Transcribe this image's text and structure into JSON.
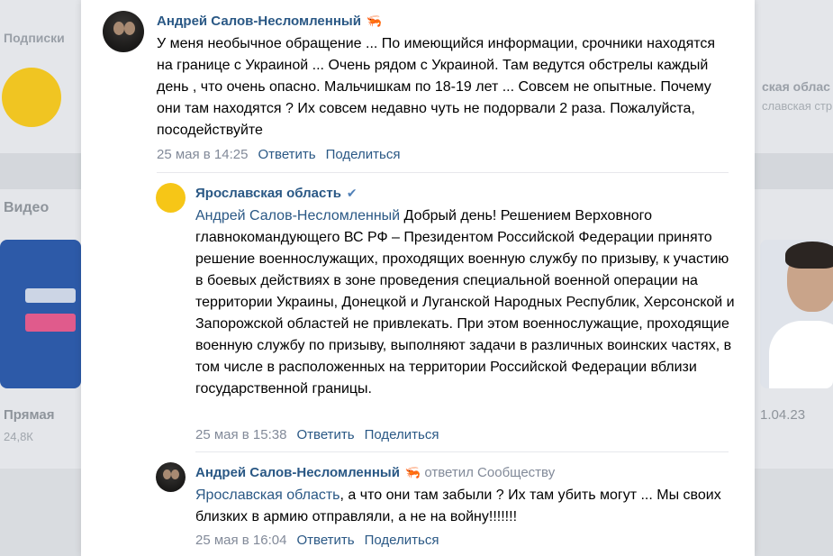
{
  "background": {
    "left": {
      "subscriptions": "Подписки",
      "video": "Видео",
      "live": "Прямая",
      "views": "24,8К"
    },
    "right": {
      "title": "ская облас",
      "subtitle": "славская стр",
      "date": "1.04.23"
    }
  },
  "comments": {
    "first": {
      "author": "Андрей Салов-Несломленный",
      "text": "У меня необычное обращение ... По имеющийся информации, срочники находятся на границе с Украиной ... Очень рядом с Украиной. Там ведутся обстрелы каждый день , что очень опасно. Мальчишкам по 18-19 лет ... Совсем не опытные. Почему они там находятся ? Их совсем недавно чуть не подорвали 2 раза. Пожалуйста, посодействуйте",
      "date": "25 мая в 14:25",
      "reply": "Ответить",
      "share": "Поделиться"
    },
    "second": {
      "author": "Ярославская область",
      "mention": "Андрей Салов-Несломленный",
      "text": " Добрый день! Решением Верховного главнокомандующего ВС РФ – Президентом Российской Федерации принято решение военнослужащих, проходящих военную службу по призыву, к участию в боевых действиях в зоне проведения специальной военной операции на территории Украины, Донецкой и Луганской Народных Республик, Херсонской и Запорожской областей не привлекать. При этом военнослужащие, проходящие военную службу по призыву, выполняют задачи в различных воинских частях, в том числе в расположенных на территории Российской Федерации вблизи государственной границы.",
      "date": "25 мая в 15:38",
      "reply": "Ответить",
      "share": "Поделиться"
    },
    "third": {
      "author": "Андрей Салов-Несломленный",
      "replied": "ответил Сообществу",
      "mention": "Ярославская область",
      "text": ", а что они там забыли ? Их там убить могут ... Мы своих близких в армию отправляли, а не на войну!!!!!!!",
      "date": "25 мая в 16:04",
      "reply": "Ответить",
      "share": "Поделиться"
    }
  },
  "icons": {
    "author_badge": "shrimp-emoji-icon",
    "verified": "verified-check-icon"
  },
  "colors": {
    "link": "#2a5885",
    "meta": "#828a99",
    "org_avatar": "#f6c617"
  }
}
